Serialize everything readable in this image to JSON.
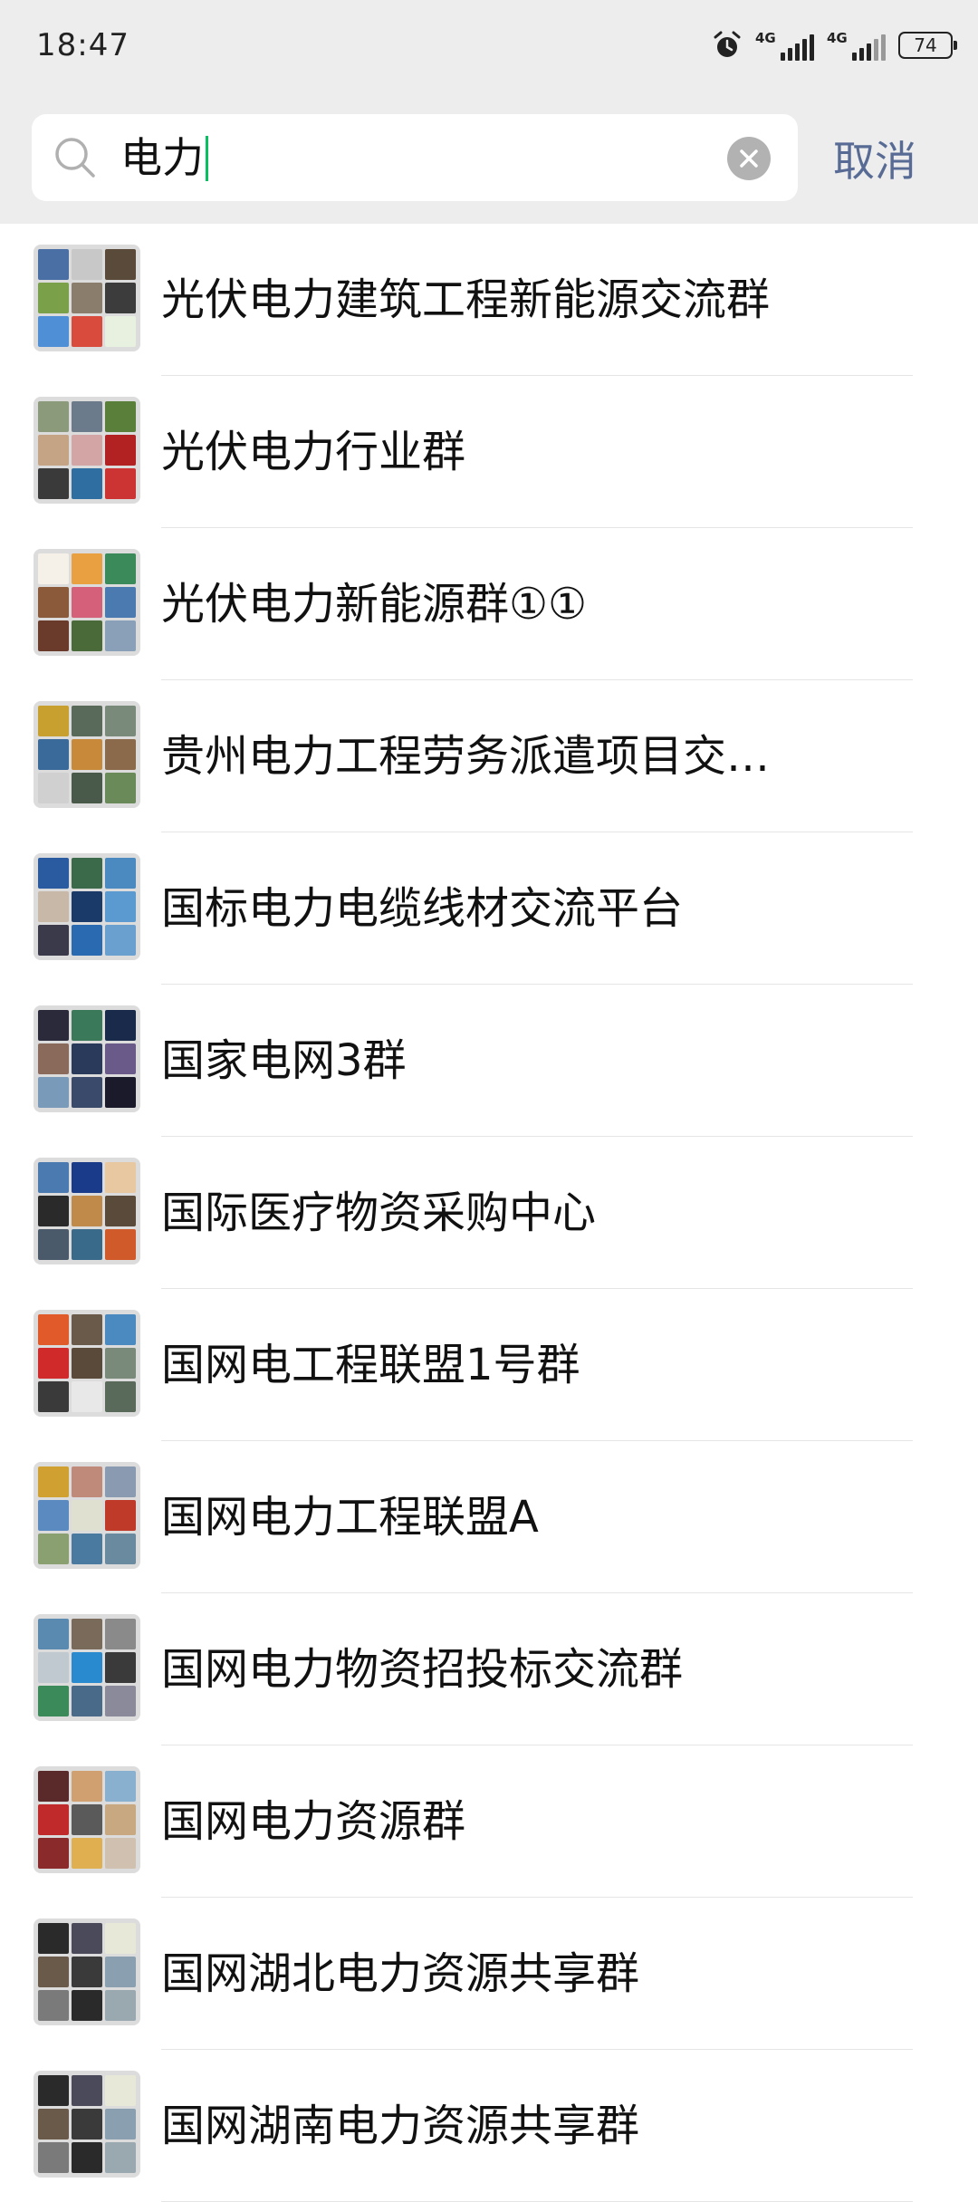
{
  "status_bar": {
    "time": "18:47",
    "alarm_icon": "alarm-clock-icon",
    "network_1": "4G",
    "network_2": "4G",
    "battery": "74"
  },
  "search": {
    "query": "电力",
    "cancel_label": "取消",
    "search_icon": "search-icon",
    "clear_icon": "clear-icon"
  },
  "results": [
    {
      "name": "光伏电力建筑工程新能源交流群",
      "colors": [
        "#4a6fa5",
        "#c8c8c8",
        "#5a4a3a",
        "#7aa04a",
        "#8b7d6b",
        "#3c3c3c",
        "#4e8fd6",
        "#d94c3d",
        "#e8f0e0"
      ]
    },
    {
      "name": "光伏电力行业群",
      "colors": [
        "#8a9a7a",
        "#6c7b8b",
        "#5a7f3a",
        "#c4a484",
        "#d4a5a5",
        "#b22222",
        "#3a3a3a",
        "#2e6ea0",
        "#cc3333"
      ]
    },
    {
      "name": "光伏电力新能源群①①",
      "colors": [
        "#f5f0e8",
        "#e8a040",
        "#3a8a5a",
        "#8a5a3a",
        "#d4607a",
        "#4a7ab0",
        "#6a3a2a",
        "#4a6a3a",
        "#8aa0b8"
      ]
    },
    {
      "name": "贵州电力工程劳务派遣项目交…",
      "colors": [
        "#c8a030",
        "#5a6a5a",
        "#7a8a7a",
        "#3a6a9a",
        "#c88a3a",
        "#8a6a4a",
        "#d0d0d0",
        "#4a5a4a",
        "#6a8a5a"
      ]
    },
    {
      "name": "国标电力电缆线材交流平台",
      "colors": [
        "#2a5aa0",
        "#3a6a4a",
        "#4a8ac0",
        "#c8b8a8",
        "#1a3a6a",
        "#5a9ad0",
        "#3a3a4a",
        "#2a6ab0",
        "#6aa0d0"
      ]
    },
    {
      "name": "国家电网3群",
      "colors": [
        "#2a2a3a",
        "#3a7a5a",
        "#1a2a4a",
        "#8a6a5a",
        "#2a3a5a",
        "#6a5a8a",
        "#7a9aba",
        "#3a4a6a",
        "#1a1a2a"
      ]
    },
    {
      "name": "国际医疗物资采购中心",
      "colors": [
        "#4a7ab0",
        "#1a3a8a",
        "#e8c8a0",
        "#2a2a2a",
        "#c08a4a",
        "#5a4a3a",
        "#4a5a6a",
        "#3a6a8a",
        "#d05a2a"
      ]
    },
    {
      "name": "国网电工程联盟1号群",
      "colors": [
        "#e05a2a",
        "#6a5a4a",
        "#4a8ac0",
        "#d02a2a",
        "#5a4a3a",
        "#7a8a7a",
        "#3a3a3a",
        "#e8e8e8",
        "#5a6a5a"
      ]
    },
    {
      "name": "国网电力工程联盟A",
      "colors": [
        "#d0a030",
        "#c08a7a",
        "#8a9ab0",
        "#5a8ac0",
        "#e0e0d0",
        "#c03a2a",
        "#8aa070",
        "#4a7aa0",
        "#6a8aa0"
      ]
    },
    {
      "name": "国网电力物资招投标交流群",
      "colors": [
        "#5a8ab0",
        "#7a6a5a",
        "#8a8a8a",
        "#c0c8d0",
        "#2a8ad0",
        "#3a3a3a",
        "#3a8a5a",
        "#4a6a8a",
        "#8a8a9a"
      ]
    },
    {
      "name": "国网电力资源群",
      "colors": [
        "#5a2a2a",
        "#d0a070",
        "#8ab0d0",
        "#c02a2a",
        "#5a5a5a",
        "#c8a880",
        "#8a2a2a",
        "#e0b050",
        "#d0c0b0"
      ]
    },
    {
      "name": "国网湖北电力资源共享群",
      "colors": [
        "#2a2a2a",
        "#4a4a5a",
        "#e8e8d8",
        "#6a5a4a",
        "#3a3a3a",
        "#8aa0b0",
        "#7a7a7a",
        "#2a2a2a",
        "#9aa8b0"
      ]
    },
    {
      "name": "国网湖南电力资源共享群",
      "colors": [
        "#2a2a2a",
        "#4a4a5a",
        "#e8e8d8",
        "#6a5a4a",
        "#3a3a3a",
        "#8aa0b0",
        "#7a7a7a",
        "#2a2a2a",
        "#9aa8b0"
      ]
    }
  ]
}
